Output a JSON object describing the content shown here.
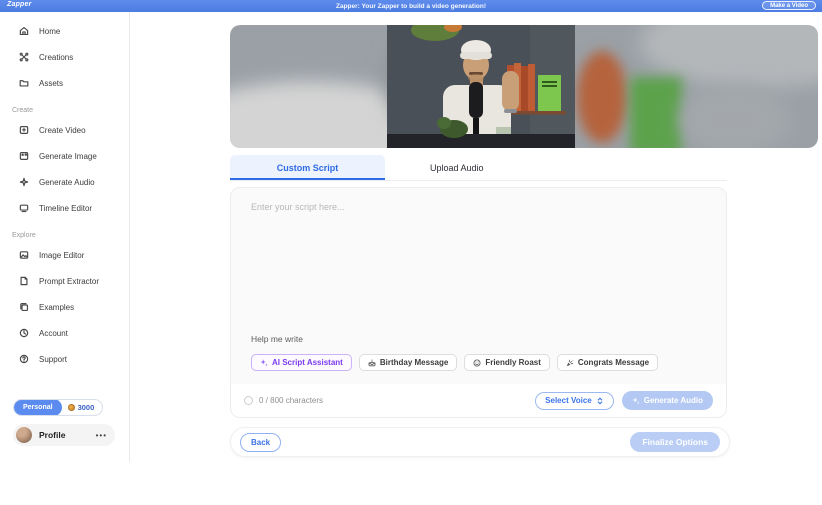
{
  "header": {
    "brand": "Zapper",
    "announcement": "Zapper: Your Zapper to build a video generation!",
    "cta": "Make a Video"
  },
  "sidebar": {
    "top_items": [
      {
        "label": "Home",
        "icon": "home-icon"
      },
      {
        "label": "Creations",
        "icon": "creations-icon"
      },
      {
        "label": "Assets",
        "icon": "assets-icon"
      }
    ],
    "create_title": "Create",
    "create_items": [
      {
        "label": "Create Video",
        "icon": "create-video-icon"
      },
      {
        "label": "Generate Image",
        "icon": "generate-image-icon"
      },
      {
        "label": "Generate Audio",
        "icon": "generate-audio-icon"
      },
      {
        "label": "Timeline Editor",
        "icon": "timeline-editor-icon"
      }
    ],
    "explore_title": "Explore",
    "explore_items": [
      {
        "label": "Image Editor",
        "icon": "image-editor-icon"
      },
      {
        "label": "Prompt Extractor",
        "icon": "prompt-extractor-icon"
      },
      {
        "label": "Examples",
        "icon": "examples-icon"
      },
      {
        "label": "Account",
        "icon": "account-icon"
      },
      {
        "label": "Support",
        "icon": "support-icon"
      }
    ],
    "plan": {
      "label": "Personal",
      "credits": "3000"
    },
    "profile": {
      "label": "Profile",
      "menu": "•••"
    }
  },
  "main": {
    "tabs": [
      {
        "label": "Custom Script",
        "active": true
      },
      {
        "label": "Upload Audio",
        "active": false
      }
    ],
    "script": {
      "placeholder": "Enter your script here...",
      "help_label": "Help me write",
      "chips": [
        {
          "label": "AI Script Assistant",
          "icon": "sparkle-icon"
        },
        {
          "label": "Birthday Message",
          "icon": "cake-icon"
        },
        {
          "label": "Friendly Roast",
          "icon": "smiley-icon"
        },
        {
          "label": "Congrats Message",
          "icon": "party-icon"
        }
      ],
      "char_count": "0 / 800 characters",
      "voice_select": "Select Voice",
      "generate_button": "Generate Audio"
    },
    "footer": {
      "back": "Back",
      "finalize": "Finalize Options"
    }
  },
  "colors": {
    "header_blue": "#517fe4",
    "accent_blue": "#2e6be6",
    "disabled_blue": "#b9cdf5",
    "ai_purple": "#7c3aed",
    "tab_active_bg": "#edf3fe"
  }
}
